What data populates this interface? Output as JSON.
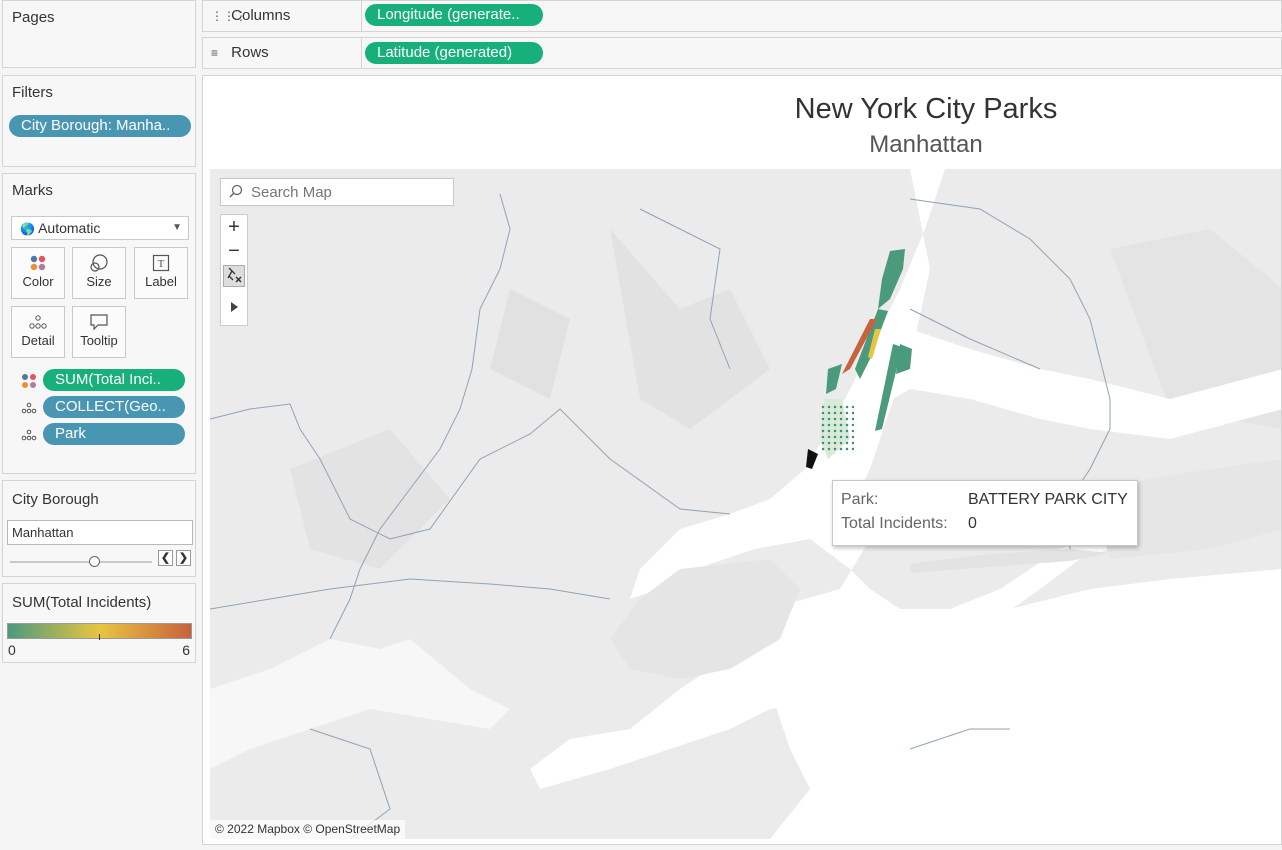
{
  "pages": {
    "title": "Pages"
  },
  "shelves": {
    "columns_label": "Columns",
    "columns_pill": "Longitude (generate..",
    "rows_label": "Rows",
    "rows_pill": "Latitude (generated)"
  },
  "filters": {
    "title": "Filters",
    "pill": "City Borough: Manha.."
  },
  "marks": {
    "title": "Marks",
    "type": "Automatic",
    "buttons": {
      "color": "Color",
      "size": "Size",
      "label": "Label",
      "detail": "Detail",
      "tooltip": "Tooltip"
    },
    "fields": [
      "SUM(Total Inci..",
      "COLLECT(Geo..",
      "Park"
    ]
  },
  "borough_filter": {
    "title": "City Borough",
    "value": "Manhattan",
    "slider_position": 0.59
  },
  "legend": {
    "title": "SUM(Total Incidents)",
    "min": "0",
    "max": "6",
    "colors": [
      "#4c9a7c",
      "#e8c540",
      "#c8613e"
    ]
  },
  "view": {
    "title": "New York City Parks",
    "subtitle": "Manhattan",
    "search_placeholder": "Search Map",
    "zoom_in": "+",
    "zoom_out": "−",
    "attribution": "© 2022 Mapbox © OpenStreetMap"
  },
  "tooltip": {
    "park_label": "Park:",
    "park_value": "BATTERY PARK CITY",
    "incidents_label": "Total Incidents:",
    "incidents_value": "0"
  }
}
